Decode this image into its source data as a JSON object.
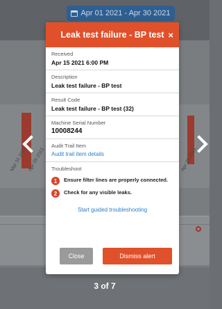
{
  "background": {
    "date_range": "Apr 01 2021 - Apr 30 2021",
    "axis_ticks": [
      "Mar 31 2021",
      "Apr 05 2021",
      "Apr 25 2021"
    ]
  },
  "modal": {
    "title": "Leak test failure - BP test",
    "close_symbol": "×",
    "fields": {
      "received": {
        "label": "Received",
        "value": "Apr 15 2021 6:00 PM"
      },
      "description": {
        "label": "Description",
        "value": "Leak test failure - BP test"
      },
      "result_code": {
        "label": "Result Code",
        "value": "Leak test failure - BP test (32)"
      },
      "serial": {
        "label": "Machine Serial Number",
        "value": "10008244"
      },
      "audit": {
        "label": "Audit Trail Item",
        "link": "Audit trail item details"
      }
    },
    "troubleshoot": {
      "label": "Troubleshoot",
      "steps": [
        {
          "num": "1",
          "text": "Ensure filter lines are properly connected."
        },
        {
          "num": "2",
          "text": "Check for any visible leaks."
        }
      ],
      "guided_link": "Start guided troubleshooting"
    },
    "buttons": {
      "close": "Close",
      "dismiss": "Dismiss alert"
    }
  },
  "pager": {
    "label": "3 of 7"
  },
  "colors": {
    "accent": "#e0502a",
    "link": "#2a7fc6",
    "close_button": "#9a9a9a"
  }
}
